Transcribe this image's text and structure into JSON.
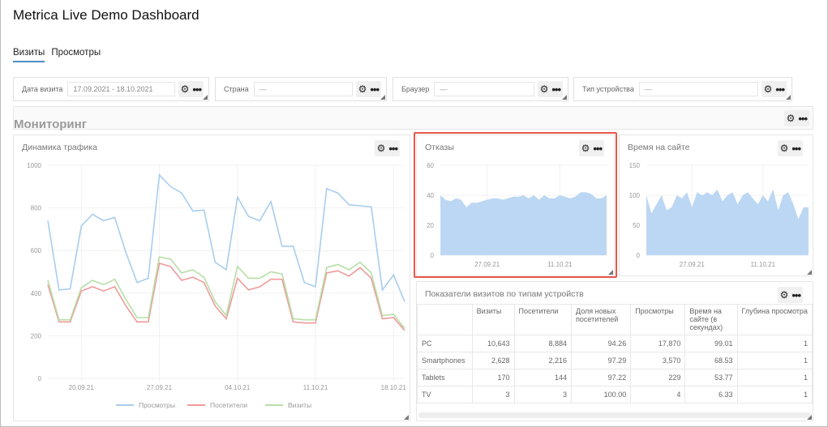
{
  "app_title": "Metrica Live Demo Dashboard",
  "tabs": [
    {
      "label": "Визиты",
      "active": true
    },
    {
      "label": "Просмотры",
      "active": false
    }
  ],
  "filters": [
    {
      "label": "Дата визита",
      "value": "17.09.2021 - 18.10.2021"
    },
    {
      "label": "Страна",
      "value": "—"
    },
    {
      "label": "Браузер",
      "value": "—"
    },
    {
      "label": "Тип устройства",
      "value": "—"
    }
  ],
  "icons": {
    "settings": "gear-icon",
    "more": "more-dots-icon",
    "resize": "resize-handle-icon"
  },
  "section": {
    "title": "Мониторинг"
  },
  "colors": {
    "views": "#a8cdee",
    "visitors": "#ef9a9a",
    "visits": "#b7dfa6",
    "area_fill": "#bcd7f3",
    "highlight": "#e8584a",
    "tab_underline": "#4a90c8"
  },
  "traffic": {
    "title": "Динамика трафика",
    "legend": [
      "Просмотры",
      "Посетители",
      "Визиты"
    ]
  },
  "bounces": {
    "title": "Отказы"
  },
  "time_on_site": {
    "title": "Время на сайте"
  },
  "device_table": {
    "title": "Показатели визитов по типам устройств",
    "columns": [
      "",
      "Визиты",
      "Посетители",
      "Доля новых посетителей",
      "Просмотры",
      "Время на сайте (в секундах)",
      "Глубина просмотра"
    ],
    "rows": [
      [
        "PC",
        "10,643",
        "8,884",
        "94.26",
        "17,870",
        "99.01",
        "1"
      ],
      [
        "Smartphones",
        "2,628",
        "2,216",
        "97.29",
        "3,570",
        "68.53",
        "1"
      ],
      [
        "Tablets",
        "170",
        "144",
        "97.22",
        "229",
        "53.77",
        "1"
      ],
      [
        "TV",
        "3",
        "3",
        "100.00",
        "4",
        "6.33",
        "1"
      ]
    ]
  },
  "chart_data": [
    {
      "type": "line",
      "x_ticks": [
        "20.09.21",
        "27.09.21",
        "04.10.21",
        "11.10.21",
        "18.10.21"
      ],
      "ylim": [
        0,
        1000
      ],
      "y_ticks": [
        0,
        200,
        400,
        600,
        800,
        1000
      ],
      "grid": true,
      "legend_position": "bottom",
      "series": [
        {
          "name": "Просмотры",
          "color": "#a8cdee",
          "values": [
            740,
            415,
            420,
            715,
            770,
            740,
            755,
            590,
            450,
            470,
            955,
            900,
            870,
            785,
            790,
            545,
            510,
            850,
            760,
            740,
            830,
            620,
            620,
            450,
            430,
            890,
            870,
            815,
            810,
            805,
            415,
            485,
            360
          ]
        },
        {
          "name": "Посетители",
          "color": "#ef9a9a",
          "values": [
            440,
            265,
            265,
            410,
            430,
            410,
            430,
            340,
            265,
            265,
            540,
            525,
            460,
            475,
            450,
            340,
            280,
            470,
            415,
            430,
            465,
            465,
            265,
            260,
            260,
            495,
            505,
            480,
            520,
            470,
            280,
            285,
            225
          ]
        },
        {
          "name": "Визиты",
          "color": "#b7dfa6",
          "values": [
            460,
            275,
            275,
            425,
            460,
            440,
            465,
            370,
            285,
            285,
            570,
            560,
            495,
            510,
            475,
            360,
            295,
            525,
            470,
            470,
            500,
            490,
            280,
            275,
            275,
            520,
            535,
            510,
            545,
            495,
            295,
            300,
            235
          ]
        }
      ]
    },
    {
      "type": "area",
      "x_ticks": [
        "27.09.21",
        "11.10.21"
      ],
      "ylim": [
        0,
        60
      ],
      "y_ticks": [
        0,
        20,
        40,
        60
      ],
      "grid": true,
      "series": [
        {
          "name": "Отказы",
          "color": "#bcd7f3",
          "values": [
            40,
            37,
            36,
            38,
            37,
            32,
            35,
            35,
            36,
            37,
            38,
            38,
            37,
            38,
            39,
            39,
            40,
            38,
            40,
            37,
            40,
            38,
            38,
            40,
            39,
            38,
            39,
            42,
            42,
            41,
            38,
            38,
            40
          ]
        }
      ]
    },
    {
      "type": "area",
      "x_ticks": [
        "27.09.21",
        "11.10.21"
      ],
      "ylim": [
        0,
        150
      ],
      "y_ticks": [
        0,
        50,
        100,
        150
      ],
      "grid": true,
      "series": [
        {
          "name": "Время на сайте",
          "color": "#bcd7f3",
          "values": [
            100,
            70,
            85,
            100,
            75,
            80,
            100,
            95,
            105,
            80,
            105,
            100,
            105,
            100,
            110,
            90,
            100,
            105,
            85,
            100,
            105,
            95,
            85,
            100,
            90,
            110,
            75,
            100,
            105,
            85,
            60,
            80,
            80
          ]
        }
      ]
    }
  ]
}
